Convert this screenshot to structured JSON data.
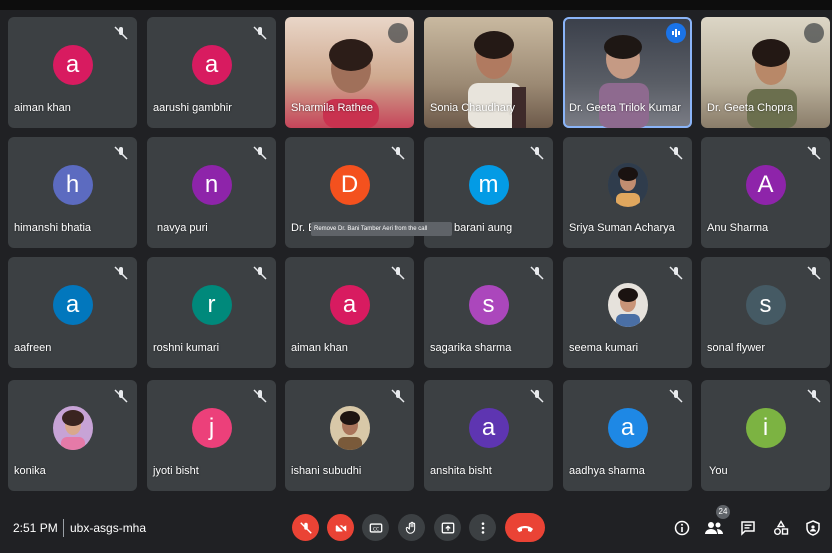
{
  "tiles": [
    {
      "name": "aiman khan",
      "initial": "a",
      "color": "#d81b60"
    },
    {
      "name": "aarushi gambhir",
      "initial": "a",
      "color": "#d81b60"
    },
    {
      "name": "Sharmila Rathee"
    },
    {
      "name": "Sonia Chaudhary"
    },
    {
      "name": "Dr. Geeta Trilok Kumar"
    },
    {
      "name": "Dr. Geeta Chopra"
    },
    {
      "name": "himanshi bhatia",
      "initial": "h",
      "color": "#5c6bc0"
    },
    {
      "name": "navya puri",
      "initial": "n",
      "color": "#8e24aa"
    },
    {
      "name": "Dr. B",
      "initial": "D",
      "color": "#f4511e"
    },
    {
      "name": "barani aung",
      "initial": "m",
      "color": "#039be5"
    },
    {
      "name": "Sriya Suman Acharya"
    },
    {
      "name": "Anu Sharma",
      "initial": "A",
      "color": "#8e24aa"
    },
    {
      "name": "aafreen",
      "initial": "a",
      "color": "#0277bd"
    },
    {
      "name": "roshni kumari",
      "initial": "r",
      "color": "#00897b"
    },
    {
      "name": "aiman khan",
      "initial": "a",
      "color": "#d81b60"
    },
    {
      "name": "sagarika sharma",
      "initial": "s",
      "color": "#ab47bc"
    },
    {
      "name": "seema kumari"
    },
    {
      "name": "sonal flywer",
      "initial": "s",
      "color": "#455a64"
    },
    {
      "name": "konika"
    },
    {
      "name": "jyoti bisht",
      "initial": "j",
      "color": "#ec407a"
    },
    {
      "name": "ishani subudhi"
    },
    {
      "name": "anshita bisht",
      "initial": "a",
      "color": "#5e35b1"
    },
    {
      "name": "aadhya sharma",
      "initial": "a",
      "color": "#1e88e5"
    },
    {
      "name": "You",
      "initial": "i",
      "color": "#7cb342"
    }
  ],
  "tooltip": "Remove Dr. Bani Tamber Aeri from the call",
  "bottom": {
    "time": "2:51 PM",
    "meeting_code": "ubx-asgs-mha",
    "participants_count": "24"
  },
  "icons": {
    "mic_off": "mic-off-icon",
    "cam_off": "camera-off-icon",
    "captions": "captions-icon",
    "hand": "raise-hand-icon",
    "present": "present-icon",
    "more": "more-icon",
    "end": "end-call-icon",
    "info": "info-icon",
    "people": "people-icon",
    "chat": "chat-icon",
    "activities": "activities-icon",
    "host": "host-controls-icon"
  },
  "colors": {
    "background": "#202124",
    "tile": "#3c4043",
    "end_call": "#ea4335",
    "speaking": "#1a73e8"
  }
}
